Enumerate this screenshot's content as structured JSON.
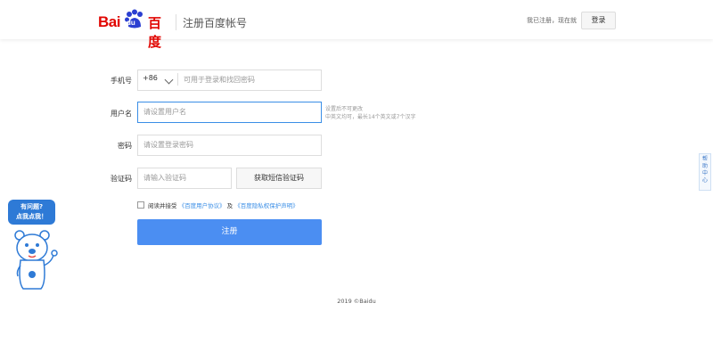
{
  "header": {
    "logo_text": "Bai",
    "logo_du": "du",
    "logo_cn": "百度",
    "title": "注册百度帐号",
    "already_registered": "我已注册，现在就",
    "login_label": "登录"
  },
  "form": {
    "phone": {
      "label": "手机号",
      "country_code": "+86",
      "placeholder": "可用于登录和找回密码"
    },
    "username": {
      "label": "用户名",
      "placeholder": "请设置用户名",
      "hint_line1": "设置后不可更改",
      "hint_line2": "中英文均可，最长14个英文或7个汉字"
    },
    "password": {
      "label": "密码",
      "placeholder": "请设置登录密码"
    },
    "captcha": {
      "label": "验证码",
      "placeholder": "请输入验证码",
      "sms_button": "获取短信验证码"
    },
    "agreement": {
      "prefix": "阅读并接受",
      "user_agreement": "《百度用户协议》",
      "and": "及",
      "privacy": "《百度隐私权保护声明》"
    },
    "submit_label": "注册"
  },
  "help_widget": {
    "bubble_line1": "有问题?",
    "bubble_line2": "点我点我！"
  },
  "help_side": {
    "c1": "帮",
    "c2": "助",
    "c3": "中",
    "c4": "心"
  },
  "footer": {
    "text": "2019 ©Baidu"
  },
  "colors": {
    "brand_red": "#e10602",
    "accent_blue": "#4b8ef2",
    "link_blue": "#3a8ee6"
  }
}
